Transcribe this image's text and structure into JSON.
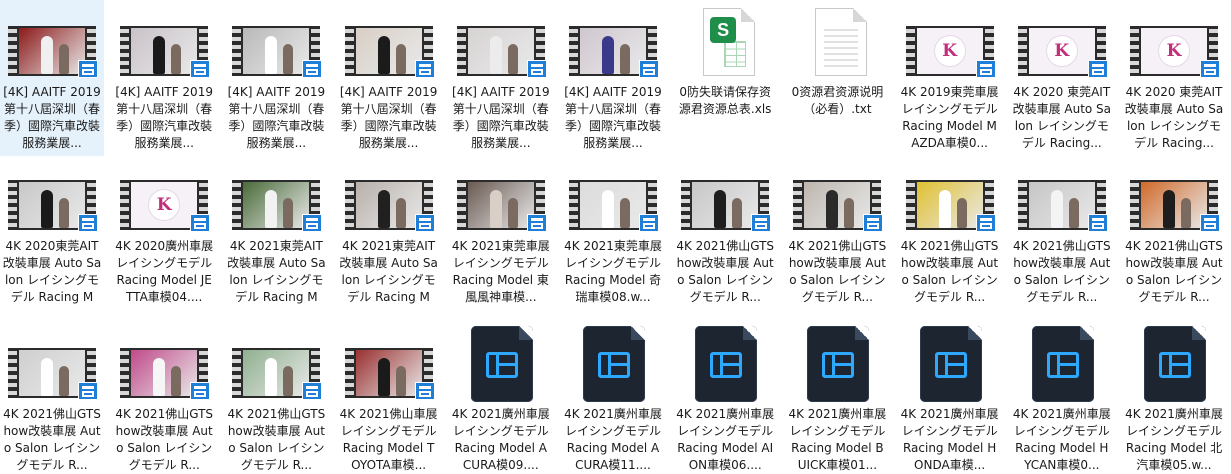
{
  "colors": {
    "selection": "#e5f1fb",
    "badge": "#1f7fd8",
    "video_icon_bg": "#1d2530",
    "video_icon_accent": "#2ea7ff",
    "xls_green": "#1e8e4a"
  },
  "files": [
    {
      "label": "[4K] AAITF 2019 第十八屆深圳（春季）國際汽車改裝服務業展...",
      "type": "video",
      "thumb": [
        "#8b1a1a",
        "#f0f0f0"
      ],
      "selected": true
    },
    {
      "label": "[4K] AAITF 2019 第十八屆深圳（春季）國際汽車改裝服務業展...",
      "type": "video",
      "thumb": [
        "#c9c2c8",
        "#1a1a1a"
      ]
    },
    {
      "label": "[4K] AAITF 2019 第十八屆深圳（春季）國際汽車改裝服務業展...",
      "type": "video",
      "thumb": [
        "#b9b9b9",
        "#ffffff"
      ]
    },
    {
      "label": "[4K] AAITF 2019 第十八屆深圳（春季）國際汽車改裝服務業展...",
      "type": "video",
      "thumb": [
        "#d8cfc6",
        "#1b1b1b"
      ]
    },
    {
      "label": "[4K] AAITF 2019 第十八屆深圳（春季）國際汽車改裝服務業展...",
      "type": "video",
      "thumb": [
        "#d7d3d3",
        "#ececec"
      ]
    },
    {
      "label": "[4K] AAITF 2019 第十八屆深圳（春季）國際汽車改裝服務業展...",
      "type": "video",
      "thumb": [
        "#cfc7cf",
        "#3a3a8a"
      ]
    },
    {
      "label": "0防失联请保存资源君资源总表.xls",
      "type": "xls"
    },
    {
      "label": "0资源君资源说明（必看）.txt",
      "type": "txt"
    },
    {
      "label": "4K 2019東莞車展 レイシングモデル Racing Model MAZDA車模0...",
      "type": "logo"
    },
    {
      "label": "4K 2020 東莞AIT改裝車展 Auto Salon レイシングモデル Racing...",
      "type": "logo"
    },
    {
      "label": "4K 2020 東莞AIT改裝車展 Auto Salon レイシングモデル Racing...",
      "type": "logo"
    },
    {
      "label": "4K 2020東莞AIT改裝車展 Auto Salon レイシングモデル Racing Mo...",
      "type": "video",
      "thumb": [
        "#c8c8c8",
        "#1a1a1a"
      ]
    },
    {
      "label": "4K 2020廣州車展 レイシングモデル Racing Model JETTA車模04....",
      "type": "logo"
    },
    {
      "label": "4K 2021東莞AIT改裝車展 Auto Salon レイシングモデル Racing Mo...",
      "type": "video",
      "thumb": [
        "#4a6b3a",
        "#f2f2f2"
      ]
    },
    {
      "label": "4K 2021東莞AIT改裝車展 Auto Salon レイシングモデル Racing Mo...",
      "type": "video",
      "thumb": [
        "#b8b0aa",
        "#202020"
      ]
    },
    {
      "label": "4K 2021東莞車展 レイシングモデル Racing Model 東風風神車模...",
      "type": "video",
      "thumb": [
        "#6a5a52",
        "#d9cfc6"
      ]
    },
    {
      "label": "4K 2021東莞車展 レイシングモデル Racing Model 奇瑞車模08.w...",
      "type": "video",
      "thumb": [
        "#dcdcdc",
        "#ffffff"
      ]
    },
    {
      "label": "4K 2021佛山GTShow改裝車展 Auto Salon レイシングモデル R...",
      "type": "video",
      "thumb": [
        "#c7c7c7",
        "#1e1e1e"
      ]
    },
    {
      "label": "4K 2021佛山GTShow改裝車展 Auto Salon レイシングモデル R...",
      "type": "video",
      "thumb": [
        "#bdb6ae",
        "#2a2a2a"
      ]
    },
    {
      "label": "4K 2021佛山GTShow改裝車展 Auto Salon レイシングモデル R...",
      "type": "video",
      "thumb": [
        "#e0c030",
        "#ffffff"
      ]
    },
    {
      "label": "4K 2021佛山GTShow改裝車展 Auto Salon レイシングモデル R...",
      "type": "video",
      "thumb": [
        "#c5c5c5",
        "#f4f4f4"
      ]
    },
    {
      "label": "4K 2021佛山GTShow改裝車展 Auto Salon レイシングモデル R...",
      "type": "video",
      "thumb": [
        "#d06a2a",
        "#1d1d1d"
      ]
    },
    {
      "label": "4K 2021佛山GTShow改裝車展 Auto Salon レイシングモデル R...",
      "type": "video",
      "thumb": [
        "#cfcfcf",
        "#ffffff"
      ]
    },
    {
      "label": "4K 2021佛山GTShow改裝車展 Auto Salon レイシングモデル R...",
      "type": "video",
      "thumb": [
        "#c04a8a",
        "#f6f6f6"
      ]
    },
    {
      "label": "4K 2021佛山GTShow改裝車展 Auto Salon レイシングモデル R...",
      "type": "video",
      "thumb": [
        "#8fb08f",
        "#ffffff"
      ]
    },
    {
      "label": "4K 2021佛山車展 レイシングモデル Racing Model TOYOTA車模...",
      "type": "video",
      "thumb": [
        "#9a3030",
        "#1a1a1a"
      ]
    },
    {
      "label": "4K 2021廣州車展 レイシングモデル Racing Model ACURA模09....",
      "type": "vfile"
    },
    {
      "label": "4K 2021廣州車展 レイシングモデル Racing Model ACURA模11....",
      "type": "vfile"
    },
    {
      "label": "4K 2021廣州車展 レイシングモデル Racing Model AION車模06....",
      "type": "vfile"
    },
    {
      "label": "4K 2021廣州車展 レイシングモデル Racing Model BUICK車模01...",
      "type": "vfile"
    },
    {
      "label": "4K 2021廣州車展 レイシングモデル Racing Model HONDA車模...",
      "type": "vfile"
    },
    {
      "label": "4K 2021廣州車展 レイシングモデル Racing Model HYCAN車模0...",
      "type": "vfile"
    },
    {
      "label": "4K 2021廣州車展 レイシングモデル Racing Model 北汽車模05.w...",
      "type": "vfile"
    }
  ]
}
